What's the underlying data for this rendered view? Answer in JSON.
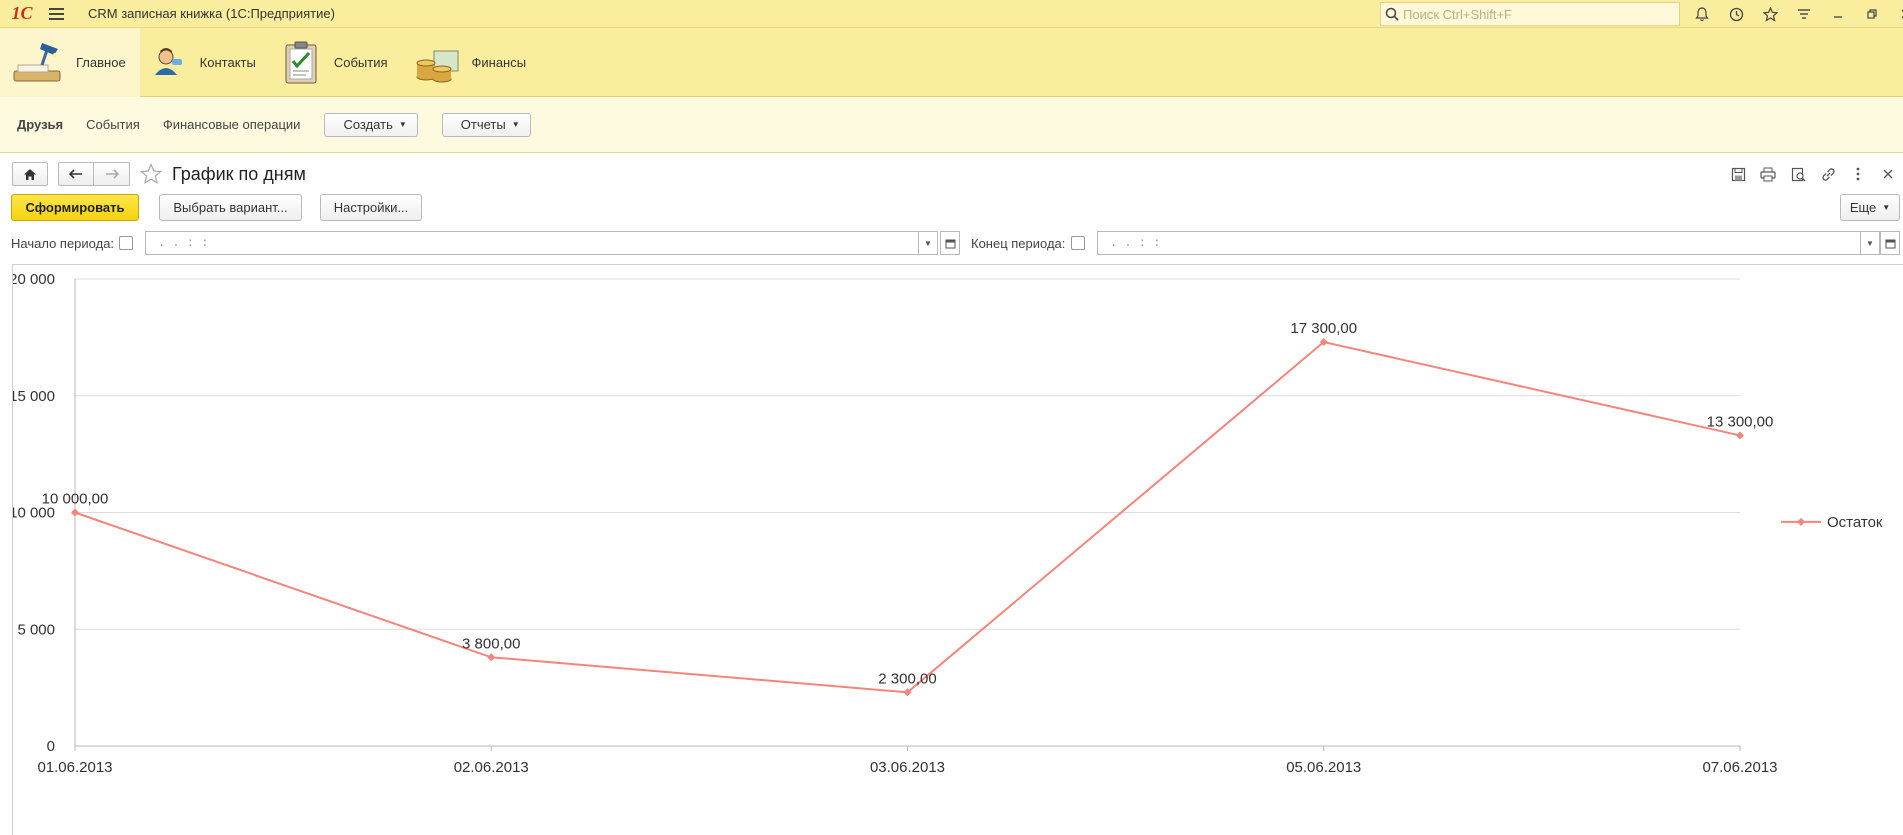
{
  "app": {
    "title": "CRM записная книжка  (1С:Предприятие)",
    "logo_text": "1С",
    "search_placeholder": "Поиск Ctrl+Shift+F"
  },
  "sections": [
    {
      "label": "Главное",
      "icon": "desk-lamp-icon",
      "active": true
    },
    {
      "label": "Контакты",
      "icon": "contacts-icon",
      "active": false
    },
    {
      "label": "События",
      "icon": "clipboard-icon",
      "active": false
    },
    {
      "label": "Финансы",
      "icon": "coins-icon",
      "active": false
    }
  ],
  "functions": {
    "links": [
      "Друзья",
      "События",
      "Финансовые операции"
    ],
    "create_label": "Создать",
    "reports_label": "Отчеты"
  },
  "form": {
    "title": "График по дням",
    "generate_label": "Сформировать",
    "choose_variant_label": "Выбрать вариант...",
    "settings_label": "Настройки...",
    "more_label": "Еще",
    "period_start_label": "Начало периода:",
    "period_end_label": "Конец периода:",
    "date_mask": " .  .        :  :"
  },
  "colors": {
    "accent_yellow": "#fbed9e",
    "primary_button": "#f5d20f",
    "series_line": "#f4857a"
  },
  "chart_data": {
    "type": "line",
    "title": "",
    "xlabel": "",
    "ylabel": "",
    "categories": [
      "01.06.2013",
      "02.06.2013",
      "03.06.2013",
      "05.06.2013",
      "07.06.2013"
    ],
    "series": [
      {
        "name": "Остаток",
        "values": [
          10000,
          3800,
          2300,
          17300,
          13300
        ],
        "color": "#f4857a"
      }
    ],
    "data_labels": [
      "10 000,00",
      "3 800,00",
      "2 300,00",
      "17 300,00",
      "13 300,00"
    ],
    "ylim": [
      0,
      20000
    ],
    "yticks": [
      0,
      5000,
      10000,
      15000,
      20000
    ],
    "ytick_labels": [
      "0",
      "5 000",
      "10 000",
      "15 000",
      "20 000"
    ],
    "grid": true,
    "legend_position": "right"
  }
}
